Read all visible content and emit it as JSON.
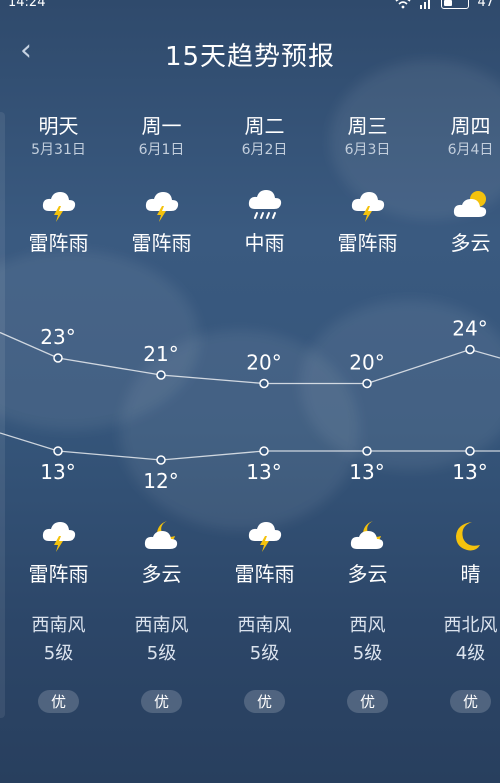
{
  "status": {
    "time": "14:24",
    "battery": "47"
  },
  "header": {
    "title": "15天趋势预报",
    "back": "‹"
  },
  "days": [
    {
      "day": "明天",
      "date": "5月31日",
      "day_icon": "thunderstorm-icon",
      "day_cond": "雷阵雨",
      "high": "23°",
      "low": "13°",
      "night_icon": "thunderstorm-icon",
      "night_cond": "雷阵雨",
      "wind": "西南风",
      "wind_level": "5级",
      "aqi": "优"
    },
    {
      "day": "周一",
      "date": "6月1日",
      "day_icon": "thunderstorm-icon",
      "day_cond": "雷阵雨",
      "high": "21°",
      "low": "12°",
      "night_icon": "partly-cloudy-night-icon",
      "night_cond": "多云",
      "wind": "西南风",
      "wind_level": "5级",
      "aqi": "优"
    },
    {
      "day": "周二",
      "date": "6月2日",
      "day_icon": "rain-icon",
      "day_cond": "中雨",
      "high": "20°",
      "low": "13°",
      "night_icon": "thunderstorm-icon",
      "night_cond": "雷阵雨",
      "wind": "西南风",
      "wind_level": "5级",
      "aqi": "优"
    },
    {
      "day": "周三",
      "date": "6月3日",
      "day_icon": "thunderstorm-icon",
      "day_cond": "雷阵雨",
      "high": "20°",
      "low": "13°",
      "night_icon": "partly-cloudy-night-icon",
      "night_cond": "多云",
      "wind": "西风",
      "wind_level": "5级",
      "aqi": "优"
    },
    {
      "day": "周四",
      "date": "6月4日",
      "day_icon": "partly-cloudy-day-icon",
      "day_cond": "多云",
      "high": "24°",
      "low": "13°",
      "night_icon": "moon-icon",
      "night_cond": "晴",
      "wind": "西北风",
      "wind_level": "4级",
      "aqi": "优"
    }
  ],
  "temps": {
    "high": [
      23,
      21,
      20,
      20,
      24
    ],
    "low": [
      13,
      12,
      13,
      13,
      13
    ],
    "prev_high": 26,
    "prev_low": 15,
    "next_high": 23
  }
}
